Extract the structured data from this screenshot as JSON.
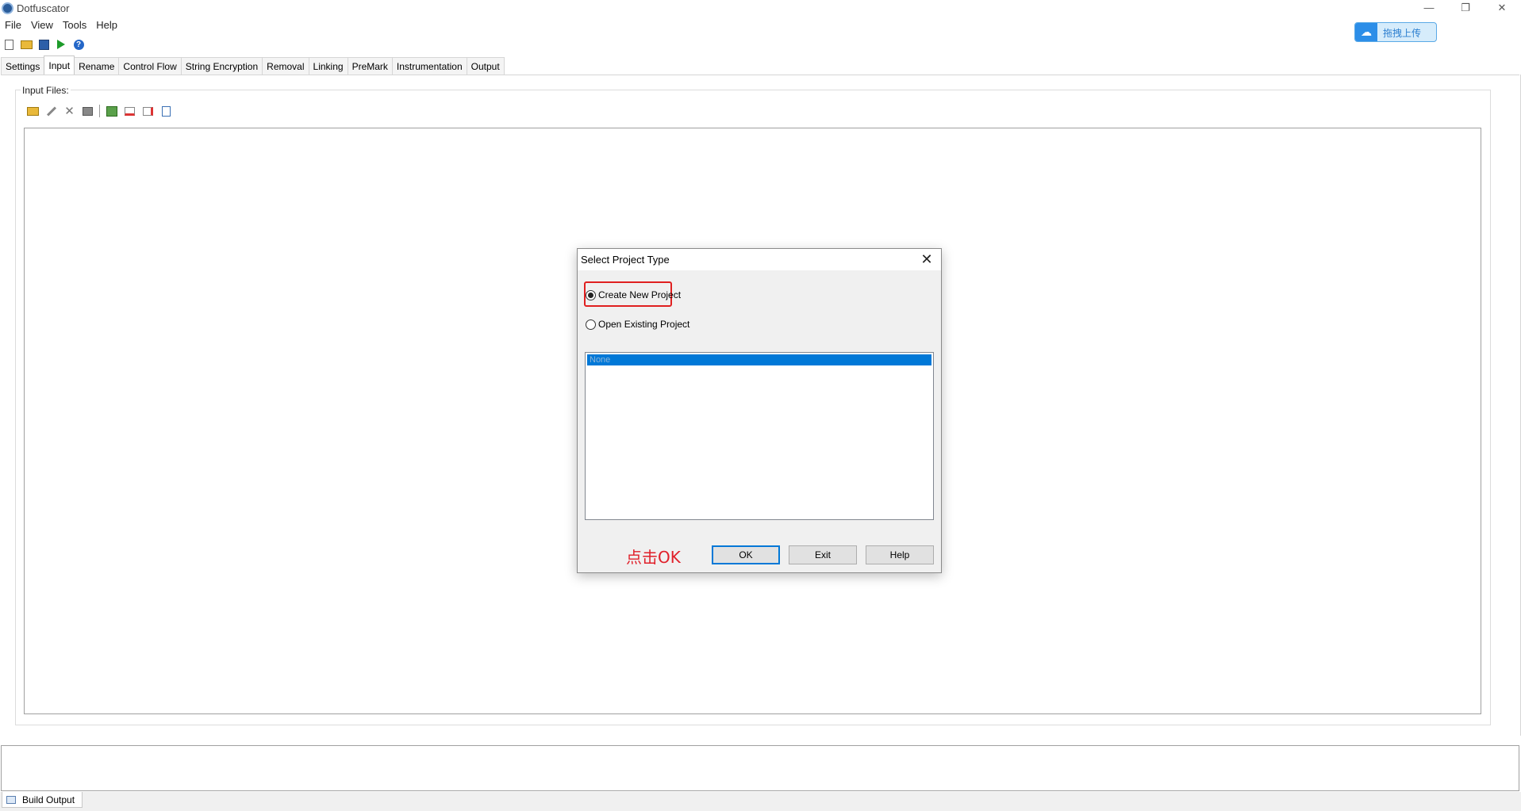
{
  "window": {
    "title": "Dotfuscator",
    "minimize": "—",
    "maximize": "❐",
    "close": "✕"
  },
  "upload_badge": {
    "label": "拖拽上传",
    "icon": "cloud-icon"
  },
  "menu": [
    "File",
    "View",
    "Tools",
    "Help"
  ],
  "toolbar": {
    "icons": [
      "new-file-icon",
      "open-folder-icon",
      "save-icon",
      "run-icon",
      "help-icon"
    ],
    "help_glyph": "?"
  },
  "tabs": [
    {
      "label": "Settings",
      "active": false
    },
    {
      "label": "Input",
      "active": true
    },
    {
      "label": "Rename",
      "active": false
    },
    {
      "label": "Control Flow",
      "active": false
    },
    {
      "label": "String Encryption",
      "active": false
    },
    {
      "label": "Removal",
      "active": false
    },
    {
      "label": "Linking",
      "active": false
    },
    {
      "label": "PreMark",
      "active": false
    },
    {
      "label": "Instrumentation",
      "active": false
    },
    {
      "label": "Output",
      "active": false
    }
  ],
  "input_files": {
    "label": "Input Files:",
    "toolbar_icons": [
      "add-folder-icon",
      "edit-icon",
      "delete-icon",
      "copy-icon",
      "grid-icon",
      "check-icon",
      "uncheck-icon",
      "document-icon"
    ],
    "x_glyph": "✕"
  },
  "build_output": {
    "tab_label": "Build Output"
  },
  "dialog": {
    "title": "Select Project Type",
    "close_glyph": "✕",
    "option_new": "Create New Project",
    "option_open": "Open Existing Project",
    "selected_option": "Create New Project",
    "list_items": [
      "None"
    ],
    "annotation": "点击OK",
    "buttons": {
      "ok": "OK",
      "exit": "Exit",
      "help": "Help"
    }
  },
  "colors": {
    "accent": "#0078d7",
    "highlight": "#e02020",
    "annotation": "#e0202a"
  }
}
